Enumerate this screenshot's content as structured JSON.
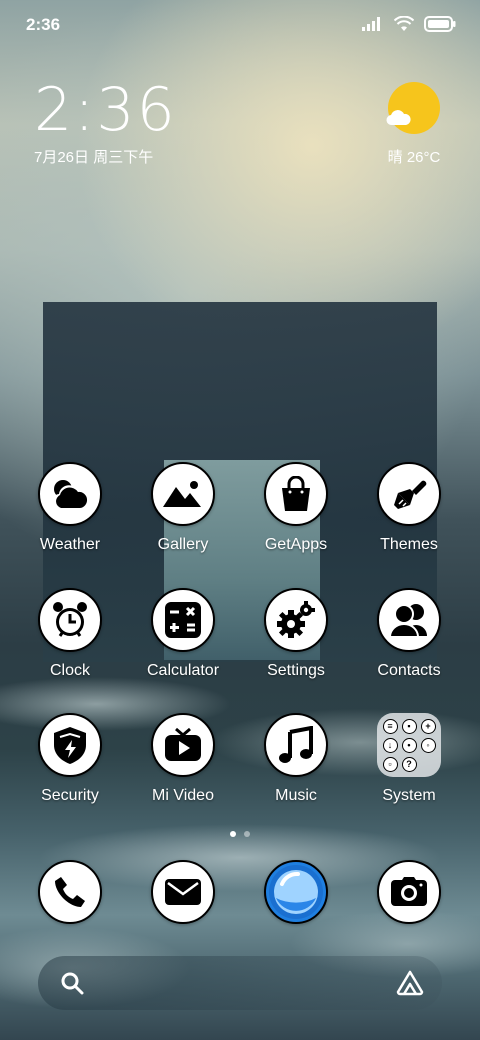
{
  "status_bar": {
    "time": "2:36",
    "icons": [
      "signal-icon",
      "wifi-icon",
      "battery-icon"
    ]
  },
  "clock_widget": {
    "time": "2:36",
    "date": "7月26日 周三下午"
  },
  "weather_widget": {
    "condition": "晴",
    "temperature": "26°C",
    "icon": "sun-icon"
  },
  "apps": [
    {
      "label": "Weather",
      "icon": "weather-cloud-icon"
    },
    {
      "label": "Gallery",
      "icon": "mountain-icon"
    },
    {
      "label": "GetApps",
      "icon": "shopping-bag-icon"
    },
    {
      "label": "Themes",
      "icon": "paintbrush-icon"
    },
    {
      "label": "Clock",
      "icon": "alarm-clock-icon"
    },
    {
      "label": "Calculator",
      "icon": "calculator-icon"
    },
    {
      "label": "Settings",
      "icon": "gears-icon"
    },
    {
      "label": "Contacts",
      "icon": "people-icon"
    },
    {
      "label": "Security",
      "icon": "shield-icon"
    },
    {
      "label": "Mi Video",
      "icon": "tv-play-icon"
    },
    {
      "label": "Music",
      "icon": "music-note-icon"
    },
    {
      "label": "System",
      "icon": "folder-icon"
    }
  ],
  "page_indicator": {
    "pages": 2,
    "current": 1
  },
  "dock": [
    {
      "name": "Phone",
      "icon": "phone-icon"
    },
    {
      "name": "Messages",
      "icon": "envelope-icon"
    },
    {
      "name": "Browser",
      "icon": "browser-icon"
    },
    {
      "name": "Camera",
      "icon": "camera-icon"
    }
  ],
  "search_bar": {
    "icon": "search-icon",
    "assistant_icon": "assistant-icon"
  },
  "colors": {
    "sun": "#f6c51c",
    "browser_blue": "#1f7fe0"
  }
}
